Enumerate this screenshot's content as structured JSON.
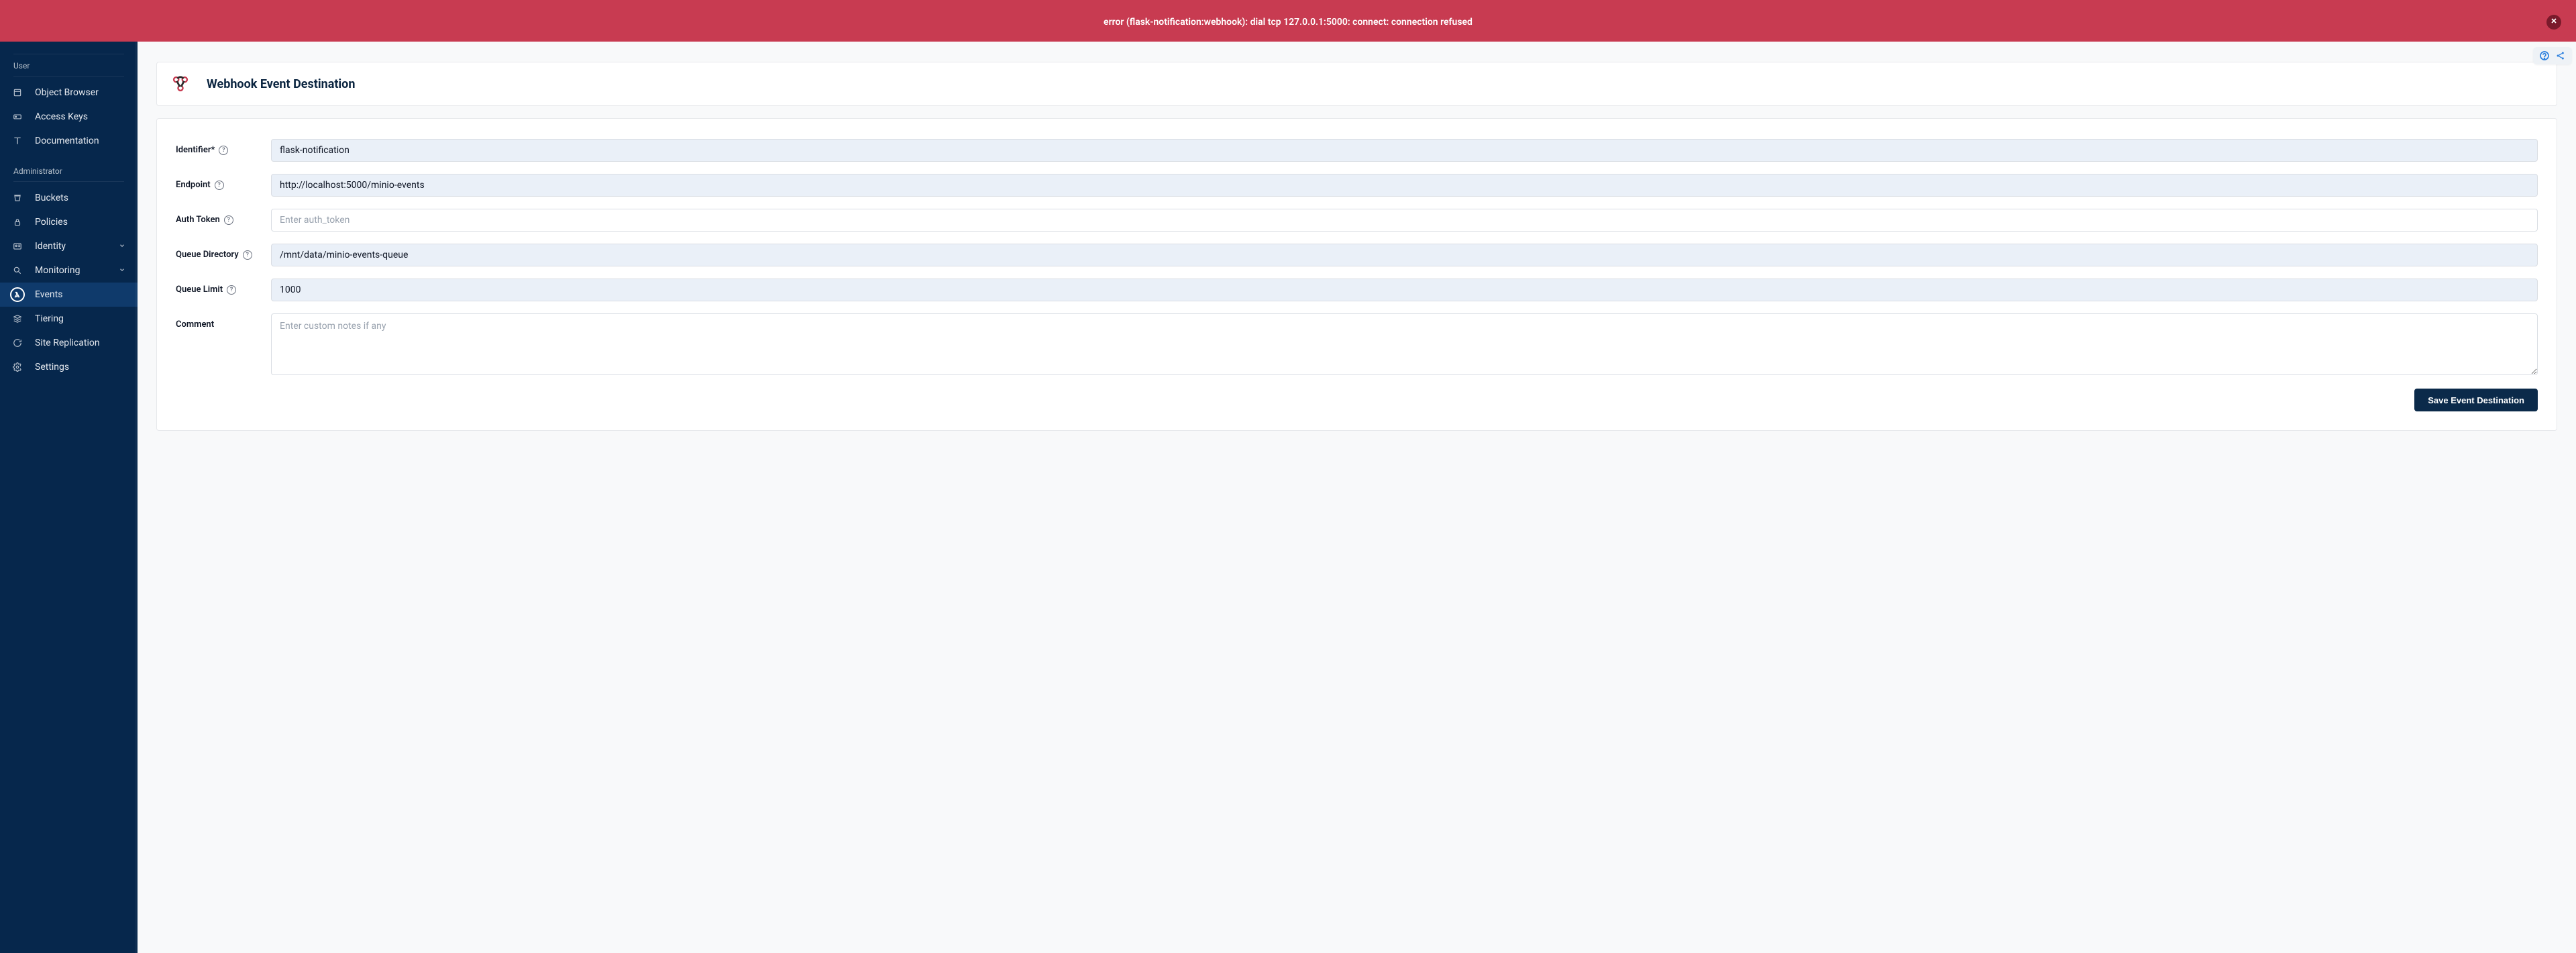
{
  "error_banner": {
    "message": "error (flask-notification:webhook): dial tcp 127.0.0.1:5000: connect: connection refused"
  },
  "sidebar": {
    "sections": {
      "user": {
        "label": "User",
        "items": [
          {
            "icon": "box-icon",
            "label": "Object Browser"
          },
          {
            "icon": "key-icon",
            "label": "Access Keys"
          },
          {
            "icon": "book-icon",
            "label": "Documentation"
          }
        ]
      },
      "admin": {
        "label": "Administrator",
        "items": [
          {
            "icon": "bucket-icon",
            "label": "Buckets"
          },
          {
            "icon": "lock-icon",
            "label": "Policies"
          },
          {
            "icon": "id-icon",
            "label": "Identity",
            "expandable": true
          },
          {
            "icon": "search-icon",
            "label": "Monitoring",
            "expandable": true
          },
          {
            "icon": "lambda-icon",
            "label": "Events",
            "active": true
          },
          {
            "icon": "tiers-icon",
            "label": "Tiering"
          },
          {
            "icon": "replication-icon",
            "label": "Site Replication"
          },
          {
            "icon": "gear-icon",
            "label": "Settings"
          }
        ]
      }
    }
  },
  "page": {
    "title": "Webhook Event Destination",
    "save_button": "Save Event Destination"
  },
  "form": {
    "identifier": {
      "label": "Identifier*",
      "value": "flask-notification"
    },
    "endpoint": {
      "label": "Endpoint",
      "value": "http://localhost:5000/minio-events"
    },
    "auth_token": {
      "label": "Auth Token",
      "value": "",
      "placeholder": "Enter auth_token"
    },
    "queue_dir": {
      "label": "Queue Directory",
      "value": "/mnt/data/minio-events-queue"
    },
    "queue_limit": {
      "label": "Queue Limit",
      "value": "1000"
    },
    "comment": {
      "label": "Comment",
      "value": "",
      "placeholder": "Enter custom notes if any"
    }
  }
}
